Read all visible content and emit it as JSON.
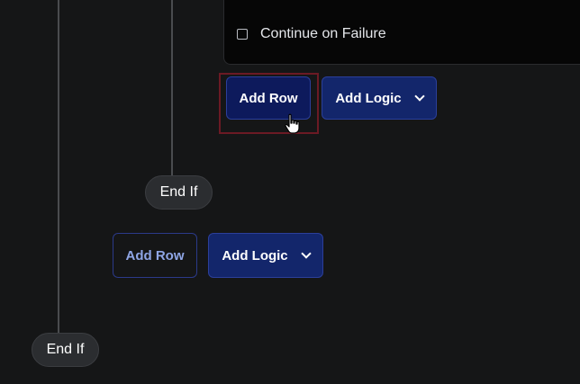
{
  "condition_panel": {
    "checkbox_label": "Continue on Failure",
    "checkbox_checked": false
  },
  "inner_block": {
    "add_row_label": "Add Row",
    "add_logic_label": "Add Logic",
    "end_label": "End If"
  },
  "outer_block": {
    "add_row_label": "Add Row",
    "add_logic_label": "Add Logic",
    "end_label": "End If"
  },
  "icons": {
    "dropdown": "chevron-down-icon",
    "cursor": "hand-pointer-cursor-icon",
    "checkbox": "checkbox-icon"
  },
  "colors": {
    "background": "#151617",
    "primary_button": "#0d1a5c",
    "logic_button": "#13266b",
    "outline_button_text": "#8fa6e6",
    "highlight": "#6b1a24",
    "pill": "#2b2d30"
  }
}
